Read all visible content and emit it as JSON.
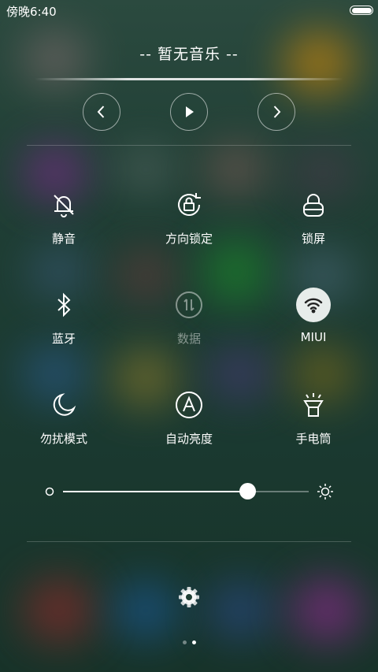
{
  "status_bar": {
    "time": "傍晚6:40",
    "battery_icon": "battery-icon"
  },
  "music": {
    "title": "-- 暂无音乐 --",
    "prev_icon": "chevron-left-icon",
    "play_icon": "play-icon",
    "next_icon": "chevron-right-icon"
  },
  "toggles": [
    {
      "label": "静音",
      "icon": "bell-off-icon",
      "state": "off"
    },
    {
      "label": "方向锁定",
      "icon": "rotation-lock-icon",
      "state": "off"
    },
    {
      "label": "锁屏",
      "icon": "lock-icon",
      "state": "off"
    },
    {
      "label": "蓝牙",
      "icon": "bluetooth-icon",
      "state": "off"
    },
    {
      "label": "数据",
      "icon": "mobile-data-icon",
      "state": "disabled"
    },
    {
      "label": "MIUI",
      "icon": "wifi-icon",
      "state": "on"
    },
    {
      "label": "勿扰模式",
      "icon": "moon-icon",
      "state": "off"
    },
    {
      "label": "自动亮度",
      "icon": "auto-brightness-icon",
      "state": "off"
    },
    {
      "label": "手电筒",
      "icon": "flashlight-icon",
      "state": "off"
    }
  ],
  "brightness": {
    "value": 0.75,
    "low_icon": "brightness-low-icon",
    "high_icon": "brightness-high-icon"
  },
  "settings": {
    "icon": "gear-icon"
  },
  "pager": {
    "count": 2,
    "active": 1
  },
  "colors": {
    "accent": "#ffffff",
    "active_toggle_bg": "#e7ecea",
    "background": "#1e3a33"
  }
}
